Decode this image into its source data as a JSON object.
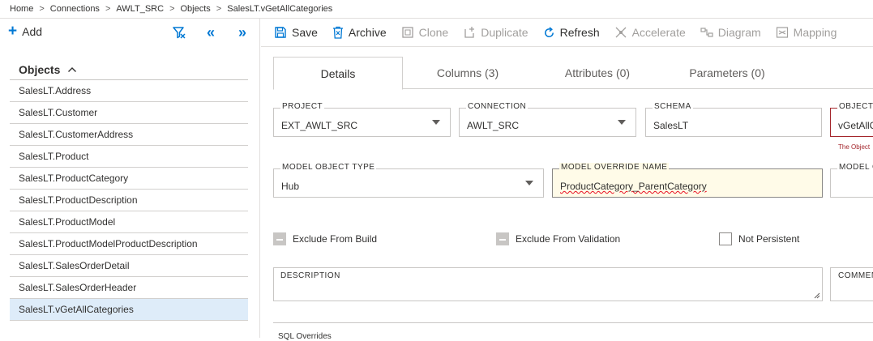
{
  "breadcrumb": [
    "Home",
    "Connections",
    "AWLT_SRC",
    "Objects",
    "SalesLT.vGetAllCategories"
  ],
  "left": {
    "add_label": "Add",
    "objects_header": "Objects",
    "items": [
      "SalesLT.Address",
      "SalesLT.Customer",
      "SalesLT.CustomerAddress",
      "SalesLT.Product",
      "SalesLT.ProductCategory",
      "SalesLT.ProductDescription",
      "SalesLT.ProductModel",
      "SalesLT.ProductModelProductDescription",
      "SalesLT.SalesOrderDetail",
      "SalesLT.SalesOrderHeader",
      "SalesLT.vGetAllCategories"
    ],
    "selected_index": 10
  },
  "toolbar": {
    "save": "Save",
    "archive": "Archive",
    "clone": "Clone",
    "duplicate": "Duplicate",
    "refresh": "Refresh",
    "accelerate": "Accelerate",
    "diagram": "Diagram",
    "mapping": "Mapping"
  },
  "tabs": [
    "Details",
    "Columns (3)",
    "Attributes (0)",
    "Parameters (0)"
  ],
  "form": {
    "project_label": "PROJECT",
    "project_value": "EXT_AWLT_SRC",
    "connection_label": "CONNECTION",
    "connection_value": "AWLT_SRC",
    "schema_label": "SCHEMA",
    "schema_value": "SalesLT",
    "object_label": "OBJECT N",
    "object_value": "vGetAllC",
    "object_error": "The Object",
    "model_type_label": "MODEL OBJECT TYPE",
    "model_type_value": "Hub",
    "override_label": "MODEL OVERRIDE NAME",
    "override_value": "ProductCategory_ParentCategory",
    "model_g_label": "MODEL G",
    "exclude_build": "Exclude From Build",
    "exclude_validation": "Exclude From Validation",
    "not_persistent": "Not Persistent",
    "description_label": "DESCRIPTION",
    "comment_label": "COMMEN",
    "bottom_label": "SQL Overrides"
  },
  "colors": {
    "accent": "#0078d4",
    "selected": "#deecf9",
    "error": "#a4262c",
    "highlight_bg": "#fffbe8"
  }
}
